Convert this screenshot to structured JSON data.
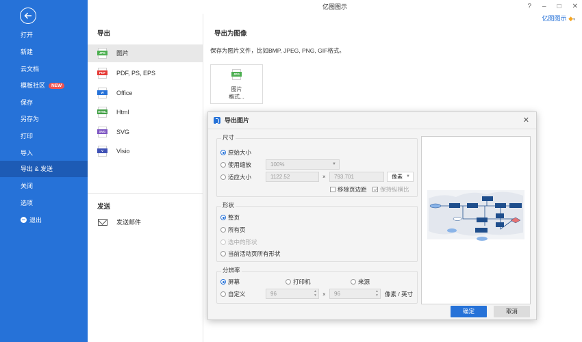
{
  "window": {
    "title": "亿图图示",
    "account": "亿图图示"
  },
  "sidebar": {
    "items": [
      {
        "label": "打开"
      },
      {
        "label": "新建"
      },
      {
        "label": "云文档"
      },
      {
        "label": "模板社区",
        "badge": "NEW"
      },
      {
        "label": "保存"
      },
      {
        "label": "另存为"
      },
      {
        "label": "打印"
      },
      {
        "label": "导入"
      },
      {
        "label": "导出 & 发送",
        "active": true
      },
      {
        "label": "关闭"
      },
      {
        "label": "选项"
      },
      {
        "label": "退出"
      }
    ]
  },
  "export": {
    "header": "导出",
    "formats": [
      {
        "label": "图片",
        "tag": "JPG",
        "color": "#4caf50",
        "active": true
      },
      {
        "label": "PDF, PS, EPS",
        "tag": "PDF",
        "color": "#e53935"
      },
      {
        "label": "Office",
        "tag": "W",
        "color": "#2672d8"
      },
      {
        "label": "Html",
        "tag": "HTML",
        "color": "#43a047"
      },
      {
        "label": "SVG",
        "tag": "SVG",
        "color": "#7e57c2"
      },
      {
        "label": "Visio",
        "tag": "V",
        "color": "#3f51b5"
      }
    ],
    "send_header": "发送",
    "send_mail": "发送邮件"
  },
  "image_panel": {
    "header": "导出为图像",
    "description": "保存为图片文件，比如BMP, JPEG, PNG, GIF格式。",
    "card_tag": "JPG",
    "card_line1": "图片",
    "card_line2": "格式..."
  },
  "dialog": {
    "title": "导出图片",
    "size": {
      "title": "尺寸",
      "original": "原始大小",
      "use_zoom": "使用缩放",
      "zoom_value": "100%",
      "fit": "适应大小",
      "width": "1122.52",
      "height": "793.701",
      "unit": "像素",
      "remove_margin": "移除页边距",
      "keep_ratio": "保持纵横比"
    },
    "shape": {
      "title": "形状",
      "whole_page": "整页",
      "all_pages": "所有页",
      "selected": "选中的形状",
      "active_all": "当前活动页所有形状"
    },
    "resolution": {
      "title": "分辨率",
      "screen": "屏幕",
      "printer": "打印机",
      "source": "来源",
      "custom": "自定义",
      "dpi_x": "96",
      "dpi_y": "96",
      "unit": "像素 / 英寸"
    },
    "ok": "确定",
    "cancel": "取消"
  },
  "colors": {
    "accent": "#2672d8",
    "sidebar_active": "#1d5bb5",
    "badge": "#ef5350"
  }
}
